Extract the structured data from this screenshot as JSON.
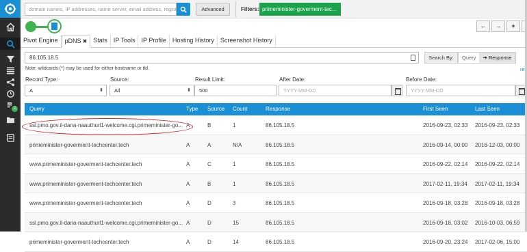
{
  "search": {
    "placeholder": "domain names, IP addresses, name server, email address, registrant na",
    "advanced_label": "Advanced"
  },
  "filters": {
    "label": "Filters:",
    "chip": "primeminister-goverment-tec..."
  },
  "nav": {
    "back": "←",
    "forward": "→",
    "add": "+"
  },
  "tabs": [
    {
      "label": "Pivot Engine"
    },
    {
      "label": "pDNS",
      "close": "✖"
    },
    {
      "label": "Stats"
    },
    {
      "label": "IP Tools"
    },
    {
      "label": "IP Profile"
    },
    {
      "label": "Hosting History"
    },
    {
      "label": "Screenshot History"
    }
  ],
  "query": {
    "value": "86.105.18.5",
    "search_by_label": "Search By:",
    "query_option": "Query",
    "response_option": "Response",
    "response_icon": "arrow-circle-icon"
  },
  "note": "Note: wildcards (*) may be used for either hostname or tld.",
  "reset_link": "res",
  "form": {
    "record_type_label": "Record Type:",
    "record_type_value": "A",
    "source_label": "Source:",
    "source_value": "All",
    "limit_label": "Result Limit:",
    "limit_value": "500",
    "after_label": "After Date:",
    "after_placeholder": "YYYY-MM-DD",
    "before_label": "Before Date:",
    "before_placeholder": "YYYY-MM-DD"
  },
  "table": {
    "headers": [
      "Query",
      "Type",
      "Source",
      "Count",
      "Response",
      "First Seen",
      "Last Seen"
    ],
    "rows": [
      [
        "ssl.pmo.gov.il-dana-naauthurl1-welcome.cgi.primeminister-go...",
        "A",
        "B",
        "1",
        "86.105.18.5",
        "2016-09-23, 02:33",
        "2016-09-23, 02:33"
      ],
      [
        "primeminister-goverment-techcenter.tech",
        "A",
        "A",
        "N/A",
        "86.105.18.5",
        "2016-09-14, 00:00",
        "2016-12-03, 00:00"
      ],
      [
        "www.primeminister-goverment-techcenter.tech",
        "A",
        "C",
        "1",
        "86.105.18.5",
        "2016-09-22, 02:14",
        "2016-09-22, 02:14"
      ],
      [
        "www.primeminister-goverment-techcenter.tech",
        "A",
        "B",
        "1",
        "86.105.18.5",
        "2017-02-11, 19:34",
        "2017-02-11, 19:34"
      ],
      [
        "www.primeminister-goverment-techcenter.tech",
        "A",
        "D",
        "3",
        "86.105.18.5",
        "2016-09-18, 03:28",
        "2016-09-18, 03:28"
      ],
      [
        "ssl.pmo.gov.il-dana-naauthurl1-welcome.cgi.primeminister-go...",
        "A",
        "D",
        "15",
        "86.105.18.5",
        "2016-09-18, 03:02",
        "2016-10-03, 06:59"
      ],
      [
        "primeminister-goverment-techcenter.tech",
        "A",
        "D",
        "14",
        "86.105.18.5",
        "2016-09-20, 23:24",
        "2017-02-06, 15:00"
      ]
    ]
  },
  "colors": {
    "accent": "#1a8fd6",
    "green": "#3fb34f",
    "annotation": "#e0161b"
  },
  "sidebar_badge": "2"
}
